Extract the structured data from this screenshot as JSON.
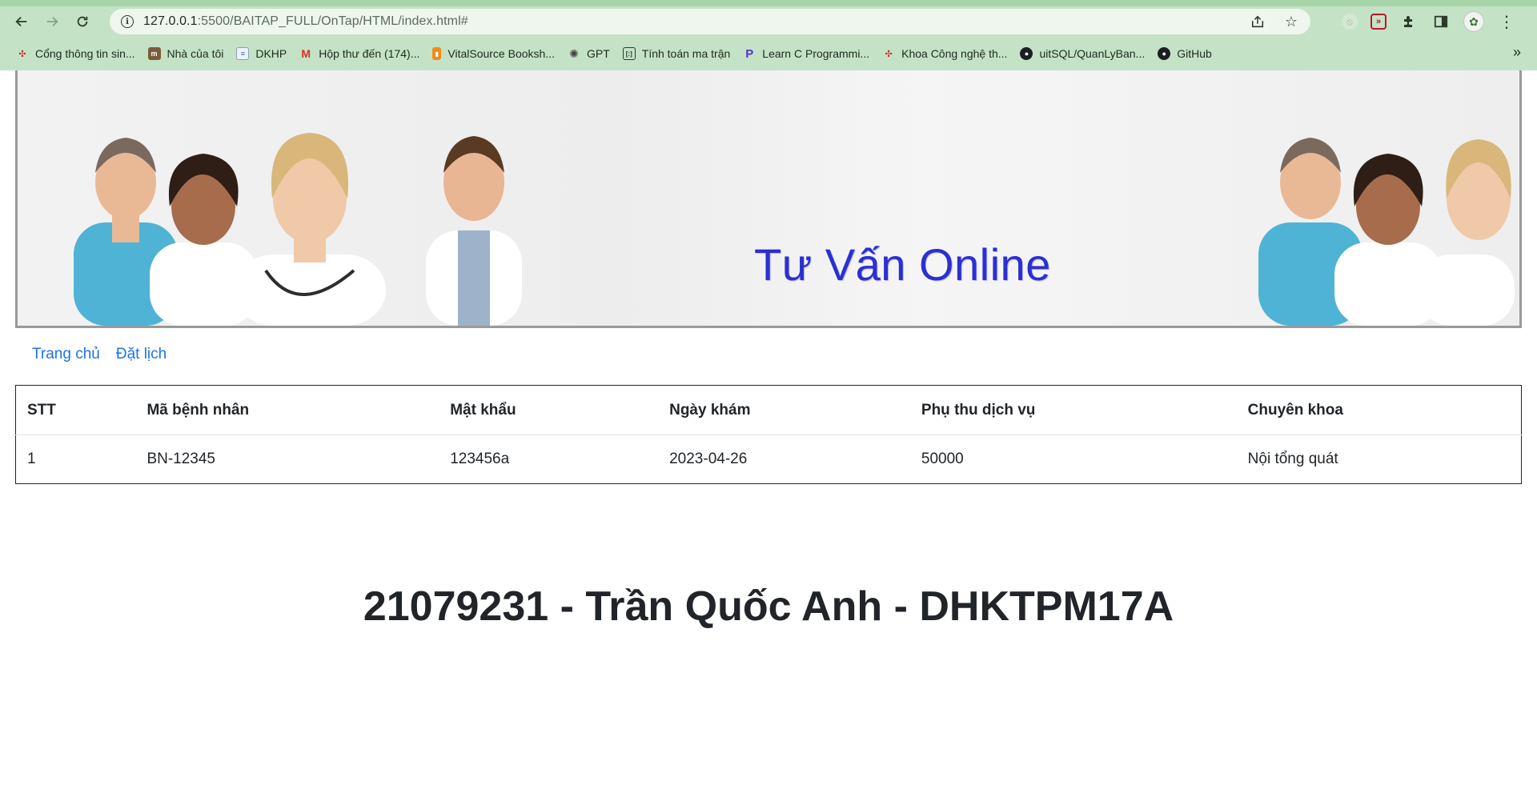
{
  "browser": {
    "url_host": "127.0.0.1",
    "url_rest": ":5500/BAITAP_FULL/OnTap/HTML/index.html#",
    "bookmarks": [
      {
        "label": "Cổng thông tin sin...",
        "icon": "university-logo-icon"
      },
      {
        "label": "Nhà của tôi",
        "icon": "moodle-logo-icon"
      },
      {
        "label": "DKHP",
        "icon": "document-icon"
      },
      {
        "label": "Hộp thư đến (174)...",
        "icon": "gmail-icon"
      },
      {
        "label": "VitalSource Booksh...",
        "icon": "vitalsource-icon"
      },
      {
        "label": "GPT",
        "icon": "openai-icon"
      },
      {
        "label": "Tính toán ma trận",
        "icon": "matrix-icon"
      },
      {
        "label": "Learn C Programmi...",
        "icon": "programiz-icon"
      },
      {
        "label": "Khoa Công nghệ th...",
        "icon": "university-logo-icon"
      },
      {
        "label": "uitSQL/QuanLyBan...",
        "icon": "github-icon"
      },
      {
        "label": "GitHub",
        "icon": "github-icon"
      }
    ],
    "overflow": "»"
  },
  "banner": {
    "title": "Tư Vấn Online"
  },
  "nav": {
    "home": "Trang chủ",
    "booking": "Đặt lịch"
  },
  "table": {
    "headers": [
      "STT",
      "Mã bệnh nhân",
      "Mật khẩu",
      "Ngày khám",
      "Phụ thu dịch vụ",
      "Chuyên khoa"
    ],
    "rows": [
      [
        "1",
        "BN-12345",
        "123456a",
        "2023-04-26",
        "50000",
        "Nội tổng quát"
      ]
    ]
  },
  "footer": {
    "text": "21079231 - Trần Quốc Anh - DHKTPM17A"
  }
}
